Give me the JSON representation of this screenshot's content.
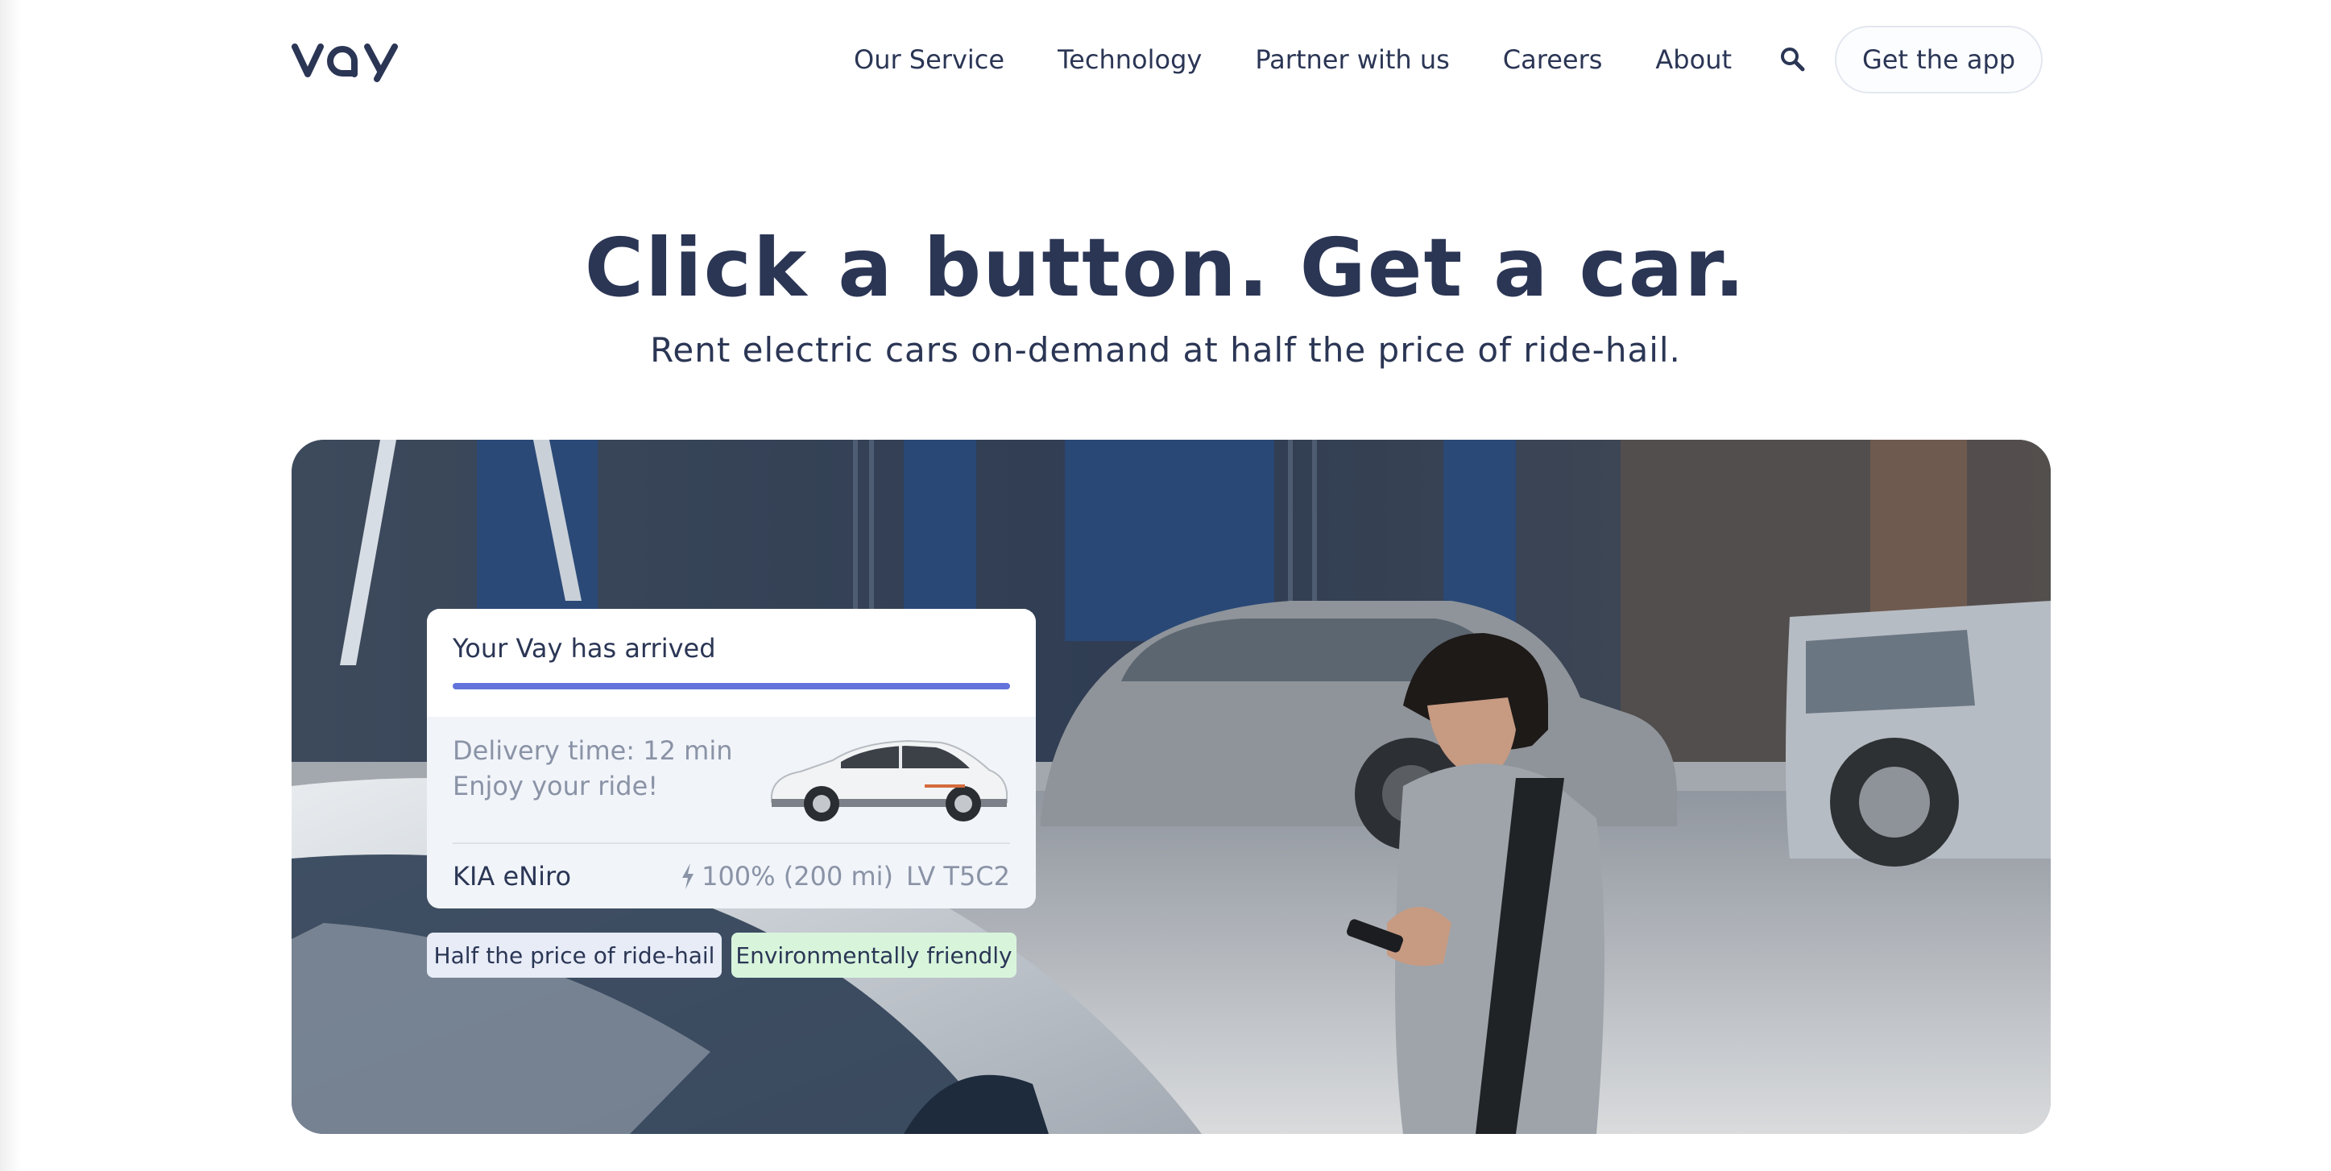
{
  "brand": {
    "logo_text": "vay",
    "color": "#2b3655"
  },
  "nav": {
    "items": [
      {
        "label": "Our Service"
      },
      {
        "label": "Technology"
      },
      {
        "label": "Partner with us"
      },
      {
        "label": "Careers"
      },
      {
        "label": "About"
      }
    ],
    "search_icon": "search-icon",
    "cta_label": "Get the app"
  },
  "hero": {
    "title": "Click a button. Get a car.",
    "subtitle": "Rent electric cars on-demand at half the price of ride-hail."
  },
  "status_card": {
    "title": "Your Vay has arrived",
    "progress": 1.0,
    "accent_color": "#6373dc",
    "delivery_text": "Delivery time: 12 min",
    "enjoy_text": "Enjoy your ride!",
    "car_model": "KIA eNiro",
    "battery_icon": "bolt-icon",
    "battery_text": "100% (200 mi)",
    "plate_text": "LV T5C2"
  },
  "tags": {
    "price": "Half the price of ride-hail",
    "eco": "Environmentally friendly"
  }
}
